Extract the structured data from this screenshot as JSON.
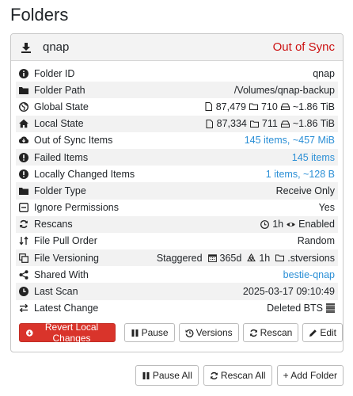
{
  "page": {
    "title": "Folders"
  },
  "folder": {
    "name": "qnap",
    "status": "Out of Sync",
    "rows": [
      {
        "label": "Folder ID",
        "icon": "info-icon",
        "value": "qnap"
      },
      {
        "label": "Folder Path",
        "icon": "folder-icon",
        "value": "/Volumes/qnap-backup"
      },
      {
        "label": "Global State",
        "icon": "globe-icon",
        "files": "87,479",
        "dirs": "710",
        "size": "~1.86 TiB"
      },
      {
        "label": "Local State",
        "icon": "home-icon",
        "files": "87,334",
        "dirs": "711",
        "size": "~1.86 TiB"
      },
      {
        "label": "Out of Sync Items",
        "icon": "cloud-download-icon",
        "value": "145 items, ~457 MiB"
      },
      {
        "label": "Failed Items",
        "icon": "exclamation-circle-icon",
        "value": "145 items"
      },
      {
        "label": "Locally Changed Items",
        "icon": "exclamation-circle-icon",
        "value": "1 items, ~128 B"
      },
      {
        "label": "Folder Type",
        "icon": "folder-icon",
        "value": "Receive Only"
      },
      {
        "label": "Ignore Permissions",
        "icon": "minus-square-icon",
        "value": "Yes"
      },
      {
        "label": "Rescans",
        "icon": "refresh-icon",
        "interval": "1h",
        "watcher": "Enabled"
      },
      {
        "label": "File Pull Order",
        "icon": "sort-icon",
        "value": "Random"
      },
      {
        "label": "File Versioning",
        "icon": "copy-icon",
        "type": "Staggered",
        "days": "365d",
        "cleanup": "1h",
        "path": ".stversions"
      },
      {
        "label": "Shared With",
        "icon": "share-icon",
        "value": "bestie-qnap"
      },
      {
        "label": "Last Scan",
        "icon": "clock-icon",
        "value": "2025-03-17 09:10:49"
      },
      {
        "label": "Latest Change",
        "icon": "exchange-icon",
        "value": "Deleted BTS"
      }
    ],
    "actions": {
      "revert": "Revert Local Changes",
      "pause": "Pause",
      "versions": "Versions",
      "rescan": "Rescan",
      "edit": "Edit"
    }
  },
  "footer": {
    "pause_all": "Pause All",
    "rescan_all": "Rescan All",
    "add_folder": "+ Add Folder"
  }
}
